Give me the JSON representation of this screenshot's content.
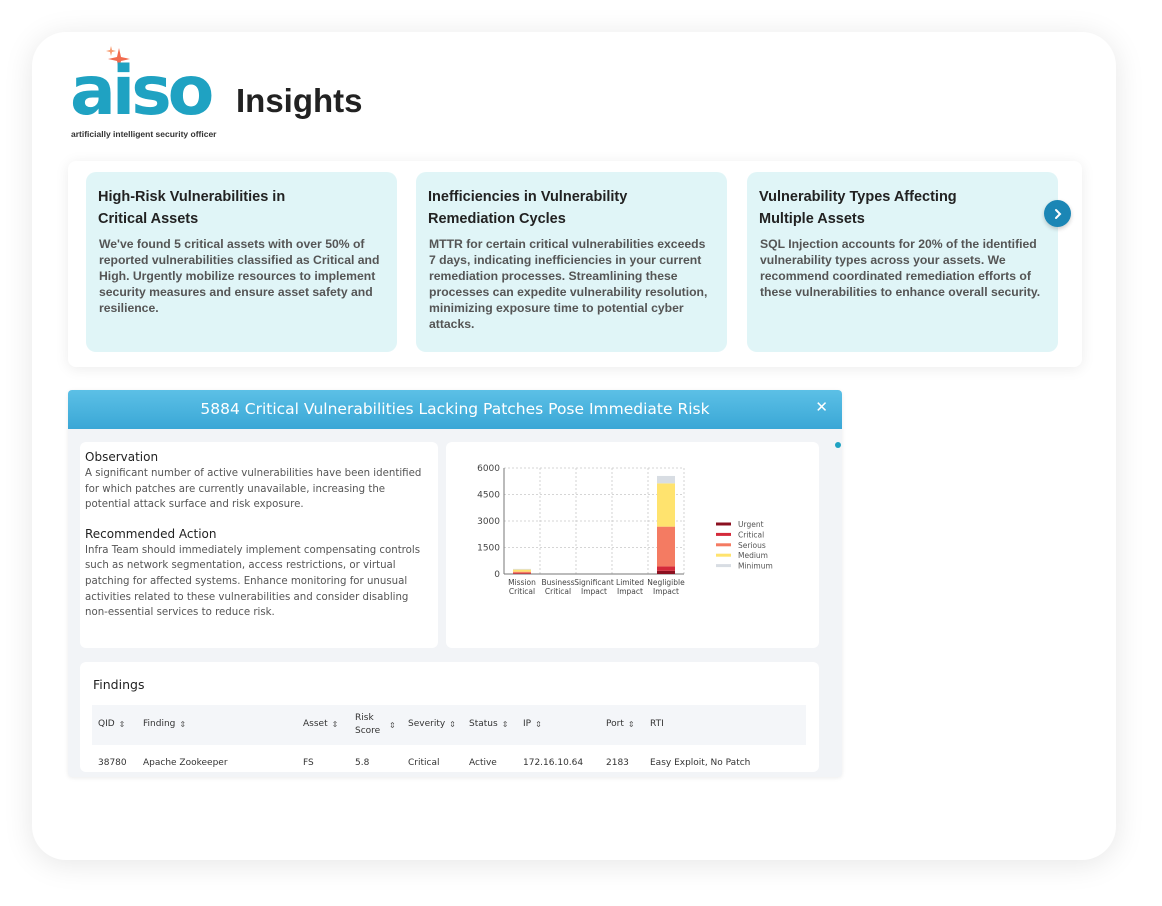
{
  "brand": {
    "name": "aiso",
    "tagline": "artificially intelligent security officer",
    "color": "#1fa2c2",
    "spark_color": "#f26b4e"
  },
  "page": {
    "title": "Insights"
  },
  "insights": [
    {
      "title": "High-Risk Vulnerabilities in Critical Assets",
      "body": "We've found 5 critical assets with over 50% of reported vulnerabilities classified as Critical and High. Urgently mobilize resources to implement security measures and ensure asset safety and resilience."
    },
    {
      "title": "Inefficiencies in Vulnerability Remediation Cycles",
      "body": "MTTR for certain critical vulnerabilities exceeds 7 days, indicating inefficiencies in your current remediation processes. Streamlining these processes can expedite vulnerability resolution, minimizing exposure time to potential cyber attacks."
    },
    {
      "title": "Vulnerability Types Affecting Multiple Assets",
      "body": "SQL Injection accounts for 20% of the identified vulnerability types across your assets. We recommend coordinated remediation efforts of these vulnerabilities to enhance overall security."
    }
  ],
  "modal": {
    "title": "5884 Critical Vulnerabilities Lacking Patches Pose Immediate Risk",
    "observation_heading": "Observation",
    "observation_text": "A significant number of active vulnerabilities have been identified for which patches are currently unavailable, increasing the potential attack surface and risk exposure.",
    "action_heading": "Recommended Action",
    "action_text": "Infra Team should immediately implement compensating controls such as network segmentation, access restrictions, or virtual patching for affected systems. Enhance monitoring for unusual activities related to these vulnerabilities and consider disabling non-essential services to reduce risk."
  },
  "chart_data": {
    "type": "bar",
    "stacked": true,
    "categories": [
      [
        "Mission",
        "Critical"
      ],
      [
        "Business",
        "Critical"
      ],
      [
        "Significant",
        "Impact"
      ],
      [
        "Limited",
        "Impact"
      ],
      [
        "Negligible",
        "Impact"
      ]
    ],
    "series": [
      {
        "name": "Urgent",
        "color": "#8b1020",
        "values": [
          20,
          0,
          0,
          0,
          180
        ]
      },
      {
        "name": "Critical",
        "color": "#d42a3a",
        "values": [
          30,
          0,
          0,
          0,
          250
        ]
      },
      {
        "name": "Serious",
        "color": "#f47b62",
        "values": [
          80,
          0,
          0,
          0,
          2250
        ]
      },
      {
        "name": "Medium",
        "color": "#ffe36e",
        "values": [
          120,
          0,
          0,
          0,
          2450
        ]
      },
      {
        "name": "Minimum",
        "color": "#d8dde3",
        "values": [
          40,
          0,
          0,
          0,
          420
        ]
      }
    ],
    "yticks": [
      0,
      1500,
      3000,
      4500,
      6000
    ],
    "ylim": [
      0,
      6000
    ],
    "grid": true,
    "legend_position": "right"
  },
  "findings": {
    "title": "Findings",
    "columns": [
      "QID",
      "Finding",
      "Asset",
      "Risk Score",
      "Severity",
      "Status",
      "IP",
      "Port",
      "RTI"
    ],
    "rows": [
      [
        "38780",
        "Apache Zookeeper",
        "FS",
        "5.8",
        "Critical",
        "Active",
        "172.16.10.64",
        "2183",
        "Easy Exploit, No Patch"
      ]
    ]
  }
}
